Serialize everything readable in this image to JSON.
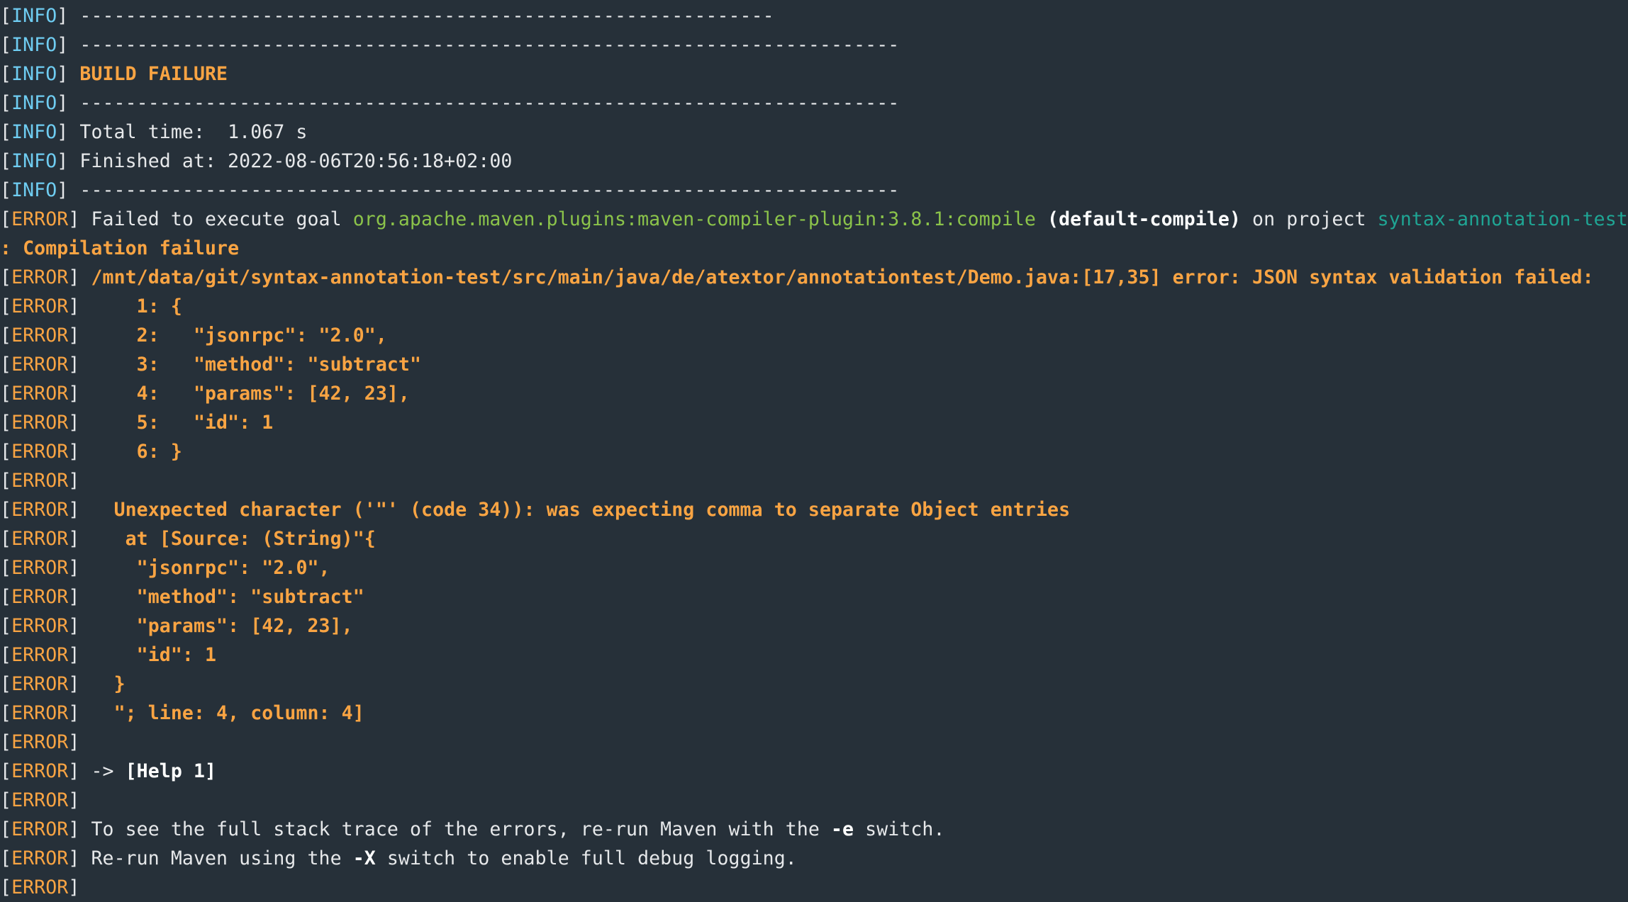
{
  "colors": {
    "background": "#263039",
    "info": "#6fcdf2",
    "error": "#f9a443",
    "plugin": "#8bc34a",
    "project": "#1fa594",
    "text": "#e6e8ea"
  },
  "lines": [
    {
      "level": "INFO",
      "segs": [
        {
          "c": "w",
          "t": " -------------------------------------------------------------"
        }
      ]
    },
    {
      "level": "INFO",
      "segs": [
        {
          "c": "w",
          "t": " ------------------------------------------------------------------------"
        }
      ]
    },
    {
      "level": "INFO",
      "segs": [
        {
          "c": "w",
          "t": " "
        },
        {
          "c": "o",
          "t": "BUILD FAILURE"
        }
      ]
    },
    {
      "level": "INFO",
      "segs": [
        {
          "c": "w",
          "t": " ------------------------------------------------------------------------"
        }
      ]
    },
    {
      "level": "INFO",
      "segs": [
        {
          "c": "w",
          "t": " Total time:  1.067 s"
        }
      ]
    },
    {
      "level": "INFO",
      "segs": [
        {
          "c": "w",
          "t": " Finished at: 2022-08-06T20:56:18+02:00"
        }
      ]
    },
    {
      "level": "INFO",
      "segs": [
        {
          "c": "w",
          "t": " ------------------------------------------------------------------------"
        }
      ]
    },
    {
      "level": "ERROR",
      "segs": [
        {
          "c": "w",
          "t": " Failed to execute goal "
        },
        {
          "c": "g",
          "t": "org.apache.maven.plugins:maven-compiler-plugin:3.8.1:compile"
        },
        {
          "c": "w",
          "t": " "
        },
        {
          "c": "b",
          "t": "(default-compile)"
        },
        {
          "c": "w",
          "t": " on project "
        },
        {
          "c": "t",
          "t": "syntax-annotation-test"
        }
      ]
    },
    {
      "level": "",
      "segs": [
        {
          "c": "o",
          "t": ": Compilation failure"
        }
      ]
    },
    {
      "level": "ERROR",
      "segs": [
        {
          "c": "w",
          "t": " "
        },
        {
          "c": "o",
          "t": "/mnt/data/git/syntax-annotation-test/src/main/java/de/atextor/annotationtest/Demo.java:[17,35] error: JSON syntax validation failed:"
        }
      ]
    },
    {
      "level": "ERROR",
      "segs": [
        {
          "c": "o",
          "t": "     1: {"
        }
      ]
    },
    {
      "level": "ERROR",
      "segs": [
        {
          "c": "o",
          "t": "     2:   \"jsonrpc\": \"2.0\","
        }
      ]
    },
    {
      "level": "ERROR",
      "segs": [
        {
          "c": "o",
          "t": "     3:   \"method\": \"subtract\""
        }
      ]
    },
    {
      "level": "ERROR",
      "segs": [
        {
          "c": "o",
          "t": "     4:   \"params\": [42, 23],"
        }
      ]
    },
    {
      "level": "ERROR",
      "segs": [
        {
          "c": "o",
          "t": "     5:   \"id\": 1"
        }
      ]
    },
    {
      "level": "ERROR",
      "segs": [
        {
          "c": "o",
          "t": "     6: }"
        }
      ]
    },
    {
      "level": "ERROR",
      "segs": []
    },
    {
      "level": "ERROR",
      "segs": [
        {
          "c": "o",
          "t": "   Unexpected character ('\"' (code 34)): was expecting comma to separate Object entries"
        }
      ]
    },
    {
      "level": "ERROR",
      "segs": [
        {
          "c": "o",
          "t": "    at [Source: (String)\"{"
        }
      ]
    },
    {
      "level": "ERROR",
      "segs": [
        {
          "c": "o",
          "t": "     \"jsonrpc\": \"2.0\","
        }
      ]
    },
    {
      "level": "ERROR",
      "segs": [
        {
          "c": "o",
          "t": "     \"method\": \"subtract\""
        }
      ]
    },
    {
      "level": "ERROR",
      "segs": [
        {
          "c": "o",
          "t": "     \"params\": [42, 23],"
        }
      ]
    },
    {
      "level": "ERROR",
      "segs": [
        {
          "c": "o",
          "t": "     \"id\": 1"
        }
      ]
    },
    {
      "level": "ERROR",
      "segs": [
        {
          "c": "o",
          "t": "   }"
        }
      ]
    },
    {
      "level": "ERROR",
      "segs": [
        {
          "c": "o",
          "t": "   \"; line: 4, column: 4]"
        }
      ]
    },
    {
      "level": "ERROR",
      "segs": []
    },
    {
      "level": "ERROR",
      "segs": [
        {
          "c": "w",
          "t": " -> "
        },
        {
          "c": "b",
          "t": "[Help 1]"
        }
      ]
    },
    {
      "level": "ERROR",
      "segs": []
    },
    {
      "level": "ERROR",
      "segs": [
        {
          "c": "w",
          "t": " To see the full stack trace of the errors, re-run Maven with the "
        },
        {
          "c": "b",
          "t": "-e"
        },
        {
          "c": "w",
          "t": " switch."
        }
      ]
    },
    {
      "level": "ERROR",
      "segs": [
        {
          "c": "w",
          "t": " Re-run Maven using the "
        },
        {
          "c": "b",
          "t": "-X"
        },
        {
          "c": "w",
          "t": " switch to enable full debug logging."
        }
      ]
    },
    {
      "level": "ERROR",
      "segs": []
    }
  ]
}
